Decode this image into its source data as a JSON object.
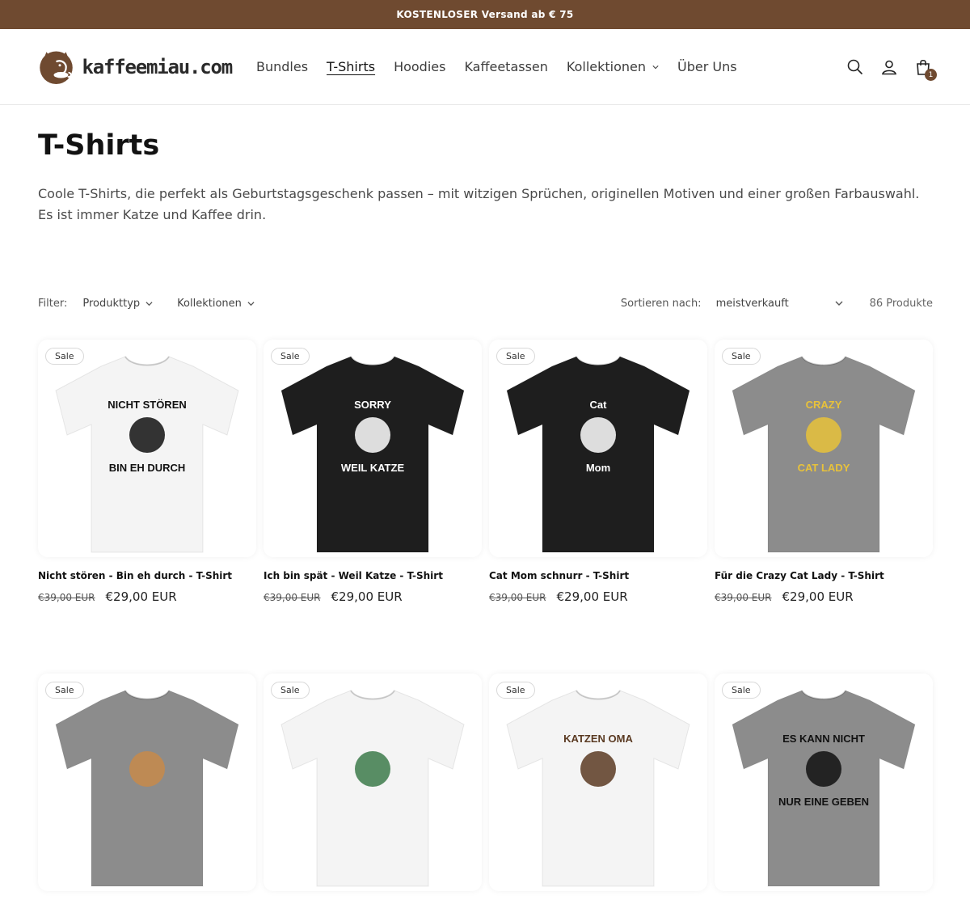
{
  "announcement": {
    "text": "KOSTENLOSER Versand ab € 75"
  },
  "header": {
    "logo_text": "kaffeemiau.com",
    "nav": [
      {
        "label": "Bundles",
        "active": false,
        "has_dropdown": false
      },
      {
        "label": "T-Shirts",
        "active": true,
        "has_dropdown": false
      },
      {
        "label": "Hoodies",
        "active": false,
        "has_dropdown": false
      },
      {
        "label": "Kaffeetassen",
        "active": false,
        "has_dropdown": false
      },
      {
        "label": "Kollektionen",
        "active": false,
        "has_dropdown": true
      },
      {
        "label": "Über Uns",
        "active": false,
        "has_dropdown": false
      }
    ],
    "cart_count": "1"
  },
  "collection": {
    "title": "T-Shirts",
    "description": "Coole T-Shirts, die perfekt als Geburtstagsgeschenk passen – mit witzigen Sprüchen, originellen Motiven und einer großen Farbauswahl. Es ist immer Katze und Kaffee drin."
  },
  "filters": {
    "label": "Filter:",
    "items": [
      "Produkttyp",
      "Kollektionen"
    ],
    "sort_label": "Sortieren nach:",
    "sort_value": "meistverkauft",
    "count": "86 Produkte"
  },
  "products": [
    {
      "title": "Nicht stören - Bin eh durch - T-Shirt",
      "badge": "Sale",
      "old_price": "€39,00 EUR",
      "price": "€29,00 EUR",
      "shirt_color": "#f4f4f4",
      "print_lines": [
        "NICHT STÖREN",
        "BIN EH DURCH"
      ],
      "print_color": "#111111"
    },
    {
      "title": "Ich bin spät - Weil Katze - T-Shirt",
      "badge": "Sale",
      "old_price": "€39,00 EUR",
      "price": "€29,00 EUR",
      "shirt_color": "#1e1e1e",
      "print_lines": [
        "SORRY",
        "WEIL KATZE"
      ],
      "print_color": "#ffffff"
    },
    {
      "title": "Cat Mom schnurr - T-Shirt",
      "badge": "Sale",
      "old_price": "€39,00 EUR",
      "price": "€29,00 EUR",
      "shirt_color": "#1e1e1e",
      "print_lines": [
        "Cat",
        "Mom"
      ],
      "print_color": "#ffffff"
    },
    {
      "title": "Für die Crazy Cat Lady - T-Shirt",
      "badge": "Sale",
      "old_price": "€39,00 EUR",
      "price": "€29,00 EUR",
      "shirt_color": "#8c8c8c",
      "print_lines": [
        "CRAZY",
        "CAT LADY"
      ],
      "print_color": "#e8c23a"
    },
    {
      "title": "",
      "badge": "Sale",
      "old_price": "",
      "price": "",
      "shirt_color": "#8c8c8c",
      "print_lines": [
        "",
        ""
      ],
      "print_color": "#c78a4a"
    },
    {
      "title": "",
      "badge": "Sale",
      "old_price": "",
      "price": "",
      "shirt_color": "#f4f4f4",
      "print_lines": [
        "",
        ""
      ],
      "print_color": "#3c7a4a"
    },
    {
      "title": "",
      "badge": "Sale",
      "old_price": "",
      "price": "",
      "shirt_color": "#f4f4f4",
      "print_lines": [
        "KATZEN OMA",
        ""
      ],
      "print_color": "#5a3a22"
    },
    {
      "title": "",
      "badge": "Sale",
      "old_price": "",
      "price": "",
      "shirt_color": "#8c8c8c",
      "print_lines": [
        "ES KANN NICHT",
        "NUR EINE GEBEN"
      ],
      "print_color": "#111111"
    }
  ],
  "colors": {
    "brand": "#6f4a30"
  }
}
